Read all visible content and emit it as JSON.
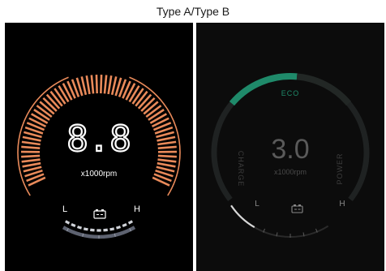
{
  "caption": "Type A/Type B",
  "type_a": {
    "speed_value": "8.8",
    "unit": "x1000rpm",
    "low_label": "L",
    "high_label": "H",
    "accent_color": "#e98a5a",
    "gauge_icon": "battery-icon",
    "fuel_level": 1.0
  },
  "type_b": {
    "speed_value": "3.0",
    "unit": "x1000rpm",
    "mode_label": "ECO",
    "left_arc_label": "CHARGE",
    "right_arc_label": "POWER",
    "low_label": "L",
    "high_label": "H",
    "accent_color": "#1f8a6a",
    "gauge_icon": "battery-icon",
    "fuel_level": 0.18
  }
}
